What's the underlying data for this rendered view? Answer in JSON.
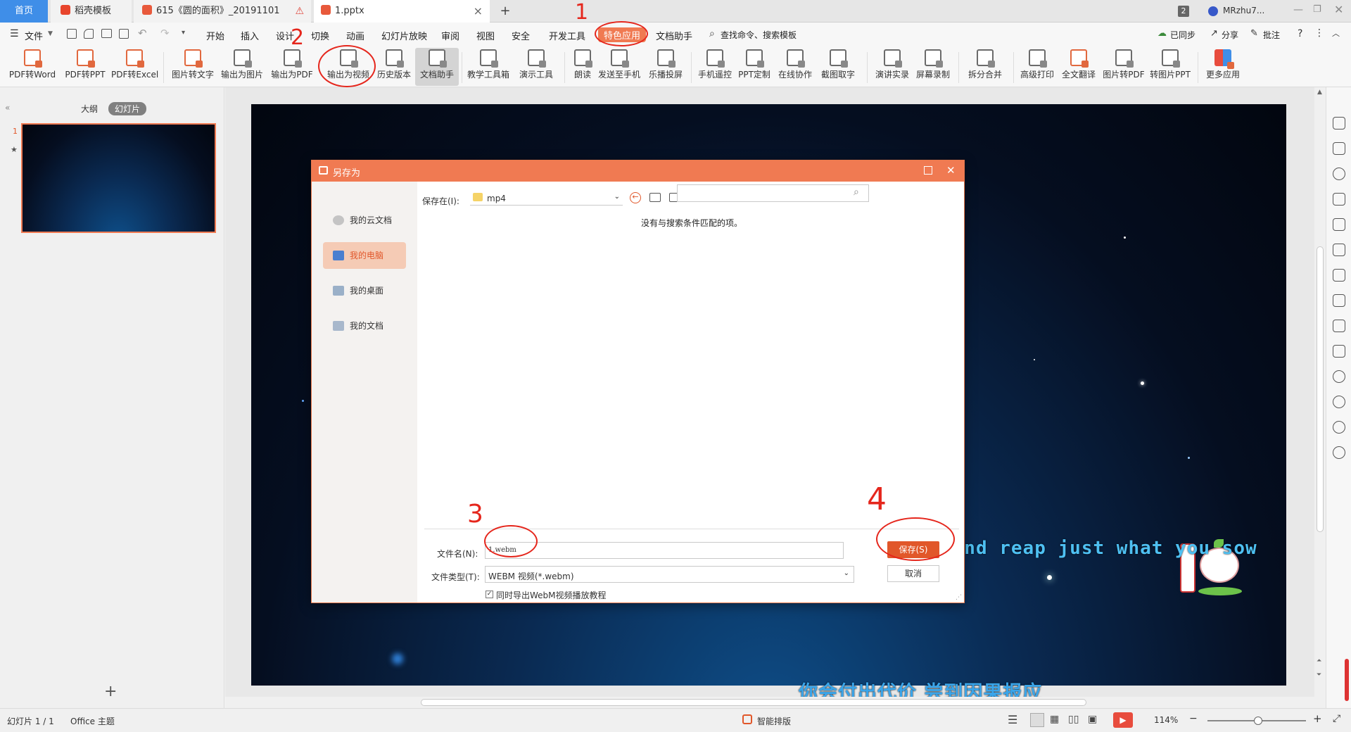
{
  "tabs": [
    {
      "label": "首页"
    },
    {
      "label": "稻壳模板"
    },
    {
      "label": "615《圆的面积》_20191101"
    },
    {
      "label": "1.pptx"
    }
  ],
  "account": {
    "badge": "2",
    "name": "MRzhu7..."
  },
  "menu": {
    "file": "文件",
    "items": [
      "开始",
      "插入",
      "设计",
      "切换",
      "动画",
      "幻灯片放映",
      "审阅",
      "视图",
      "安全",
      "开发工具",
      "特色应用",
      "文档助手"
    ],
    "search": "查找命令、搜索模板",
    "sync": "已同步",
    "share": "分享",
    "comment": "批注"
  },
  "ribbon": [
    "PDF转Word",
    "PDF转PPT",
    "PDF转Excel",
    "图片转文字",
    "输出为图片",
    "输出为PDF",
    "输出为视频",
    "历史版本",
    "文档助手",
    "教学工具箱",
    "演示工具",
    "朗读",
    "发送至手机",
    "乐播投屏",
    "手机遥控",
    "PPT定制",
    "在线协作",
    "截图取字",
    "演讲实录",
    "屏幕录制",
    "拆分合并",
    "高级打印",
    "全文翻译",
    "图片转PDF",
    "转图片PPT",
    "更多应用"
  ],
  "leftpane": {
    "outline": "大纲",
    "slides": "幻灯片",
    "slide_number": "1",
    "add": "+"
  },
  "slide": {
    "subtitle_en": "You'll pay me back in kind and reap just what you sow",
    "subtitle_cn": "你会付出代价 尝到因果报应"
  },
  "dialog": {
    "title": "另存为",
    "nav": [
      "我的云文档",
      "我的电脑",
      "我的桌面",
      "我的文档"
    ],
    "save_in_label": "保存在(I):",
    "save_in_value": "mp4",
    "empty_message": "没有与搜索条件匹配的项。",
    "filename_label": "文件名(N):",
    "filename_value": "1.webm",
    "filetype_label": "文件类型(T):",
    "filetype_value": "WEBM 视频(*.webm)",
    "save_button": "保存(S)",
    "cancel_button": "取消",
    "checkbox_label": "同时导出WebM视频播放教程"
  },
  "annotations": [
    "1",
    "2",
    "3",
    "4"
  ],
  "status": {
    "slide_info": "幻灯片 1 / 1",
    "theme": "Office 主题",
    "smart": "智能排版",
    "zoom": "114%"
  },
  "colors": {
    "accent": "#f07a52",
    "annotation": "#e5261c",
    "tab_active": "#4a90d9"
  }
}
